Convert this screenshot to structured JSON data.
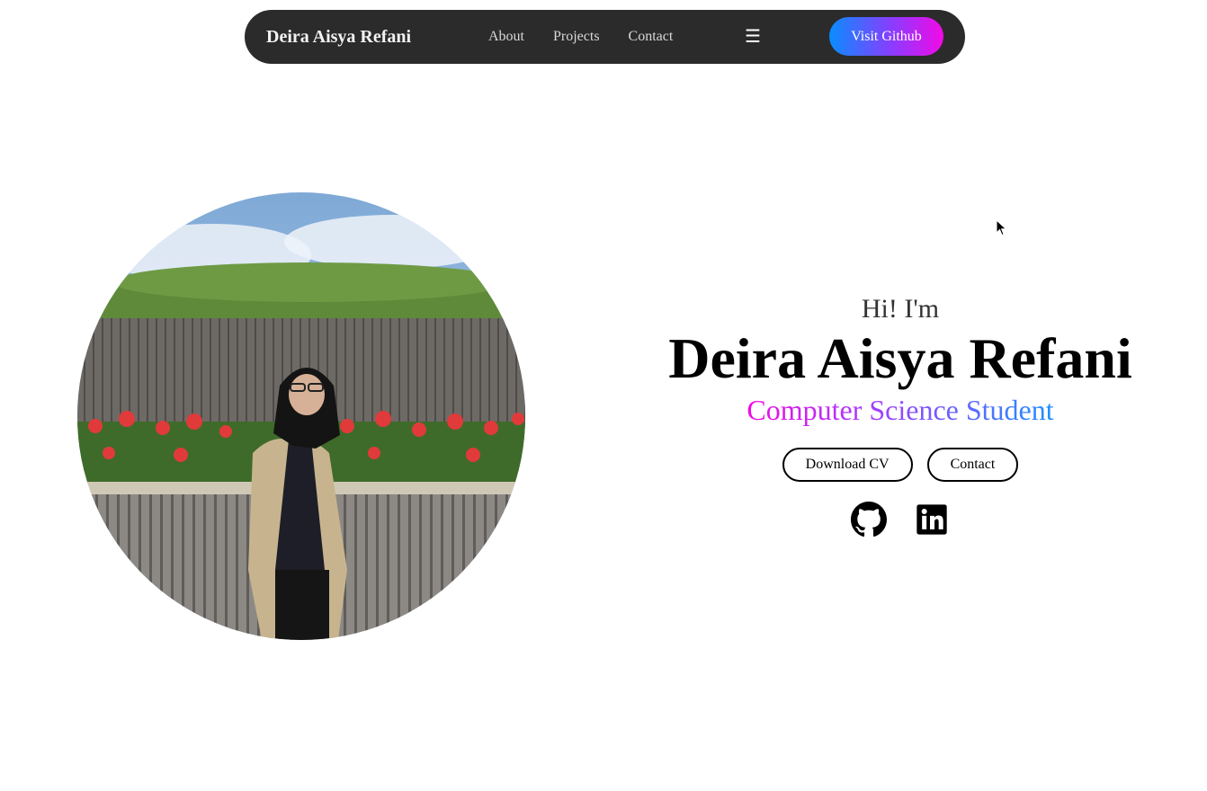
{
  "navbar": {
    "brand": "Deira Aisya Refani",
    "links": [
      {
        "label": "About"
      },
      {
        "label": "Projects"
      },
      {
        "label": "Contact"
      }
    ],
    "menu_icon": "☰",
    "github_button": "Visit Github"
  },
  "hero": {
    "greeting": "Hi! I'm",
    "name": "Deira Aisya Refani",
    "role": "Computer Science Student",
    "buttons": {
      "download_cv": "Download CV",
      "contact": "Contact"
    },
    "socials": [
      {
        "icon": "github-icon"
      },
      {
        "icon": "linkedin-icon"
      }
    ]
  },
  "colors": {
    "navbar_bg": "#2b2b2b",
    "gradient_start": "#0a8dff",
    "gradient_mid": "#8a3cff",
    "gradient_end": "#f20ae6"
  }
}
